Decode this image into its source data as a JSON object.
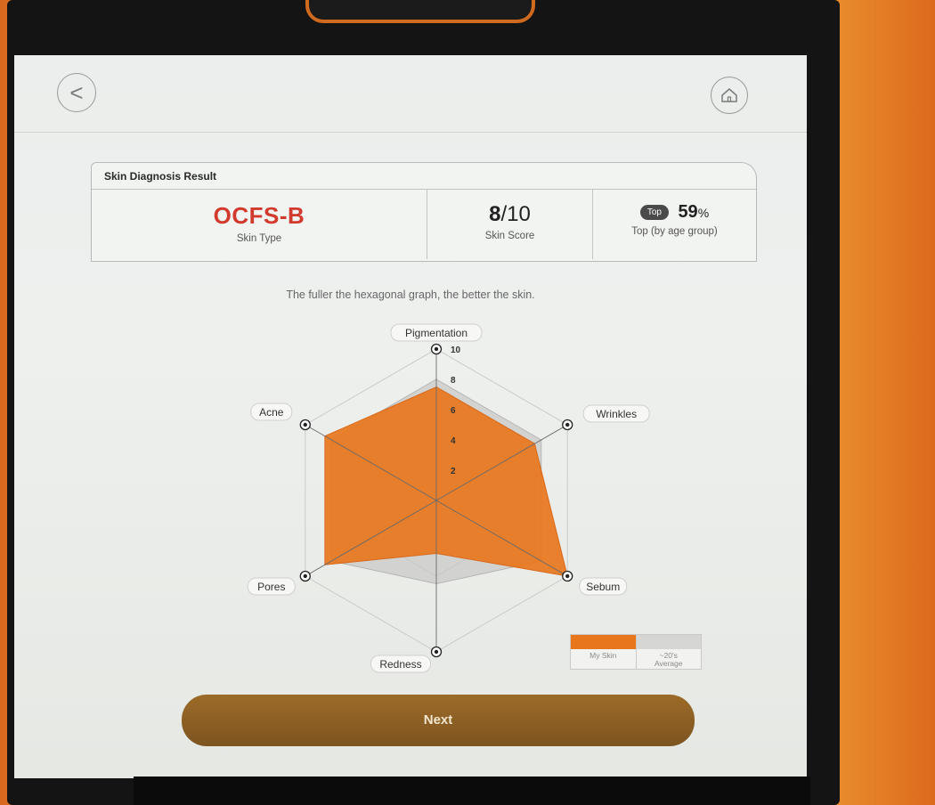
{
  "header": {
    "back_label": "<",
    "home_icon": "home-icon"
  },
  "result": {
    "title": "Skin Diagnosis Result",
    "skin_type_value": "OCFS-B",
    "skin_type_label": "Skin Type",
    "score_value": "8",
    "score_max": "/10",
    "score_label": "Skin Score",
    "top_badge": "Top",
    "top_value": "59",
    "top_unit": "%",
    "top_label": "Top (by age group)"
  },
  "hint": "The fuller the hexagonal graph, the better the skin.",
  "chart_data": {
    "type": "radar",
    "axes": [
      "Pigmentation",
      "Wrinkles",
      "Sebum",
      "Redness",
      "Pores",
      "Acne"
    ],
    "ticks": [
      "2",
      "4",
      "6",
      "8",
      "10"
    ],
    "rmax": 10,
    "series": [
      {
        "name": "My Skin",
        "values": [
          7.5,
          7.5,
          10,
          3.5,
          8.5,
          8.5
        ],
        "color": "#e7761d"
      },
      {
        "name": "~20's Average",
        "values": [
          8,
          8,
          8,
          5.5,
          8,
          8
        ],
        "color": "#c8c8c6"
      }
    ]
  },
  "legend": {
    "mine": "My Skin",
    "avg_line1": "~20's",
    "avg_line2": "Average"
  },
  "next_label": "Next",
  "colors": {
    "accent": "#e7761d",
    "type_red": "#d23a2e",
    "button_brown": "#8a5e24"
  }
}
